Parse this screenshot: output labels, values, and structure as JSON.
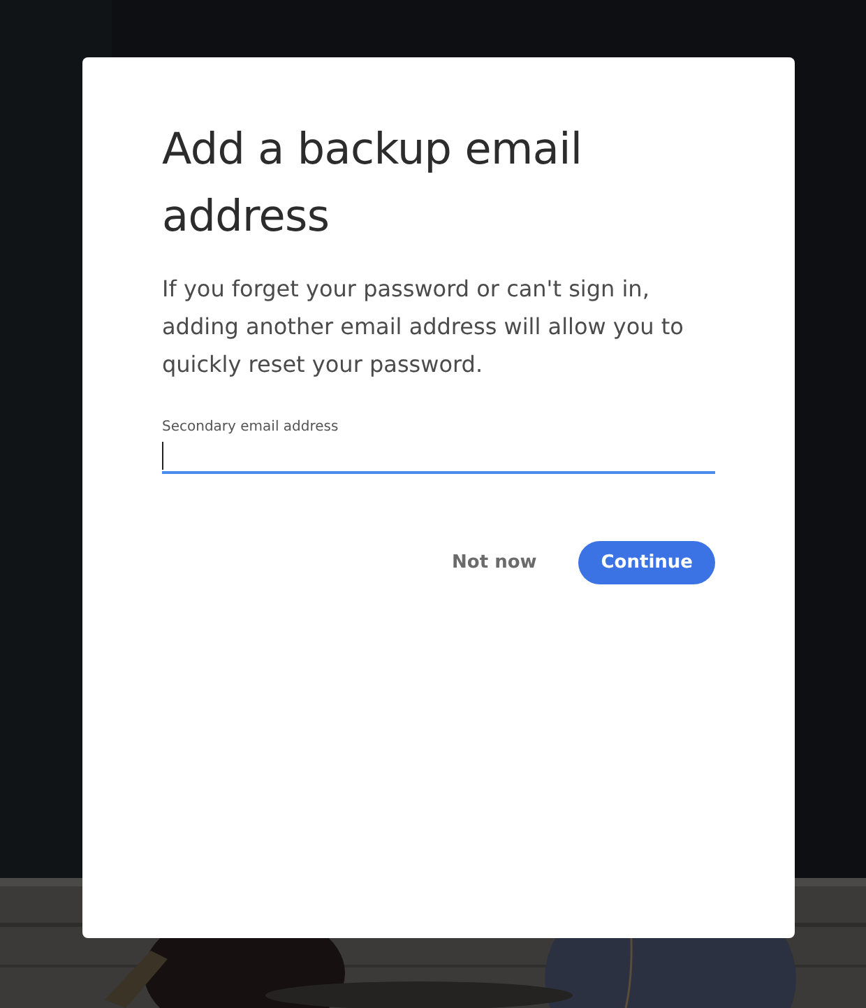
{
  "dialog": {
    "title": "Add a backup email address",
    "description": "If you forget your password or can't sign in, adding another email address will allow you to quickly reset your password.",
    "field": {
      "label": "Secondary email address",
      "focused": true
    },
    "buttons": [
      {
        "label": "Not now",
        "kind": "secondary"
      },
      {
        "label": "Continue",
        "kind": "primary"
      }
    ]
  }
}
